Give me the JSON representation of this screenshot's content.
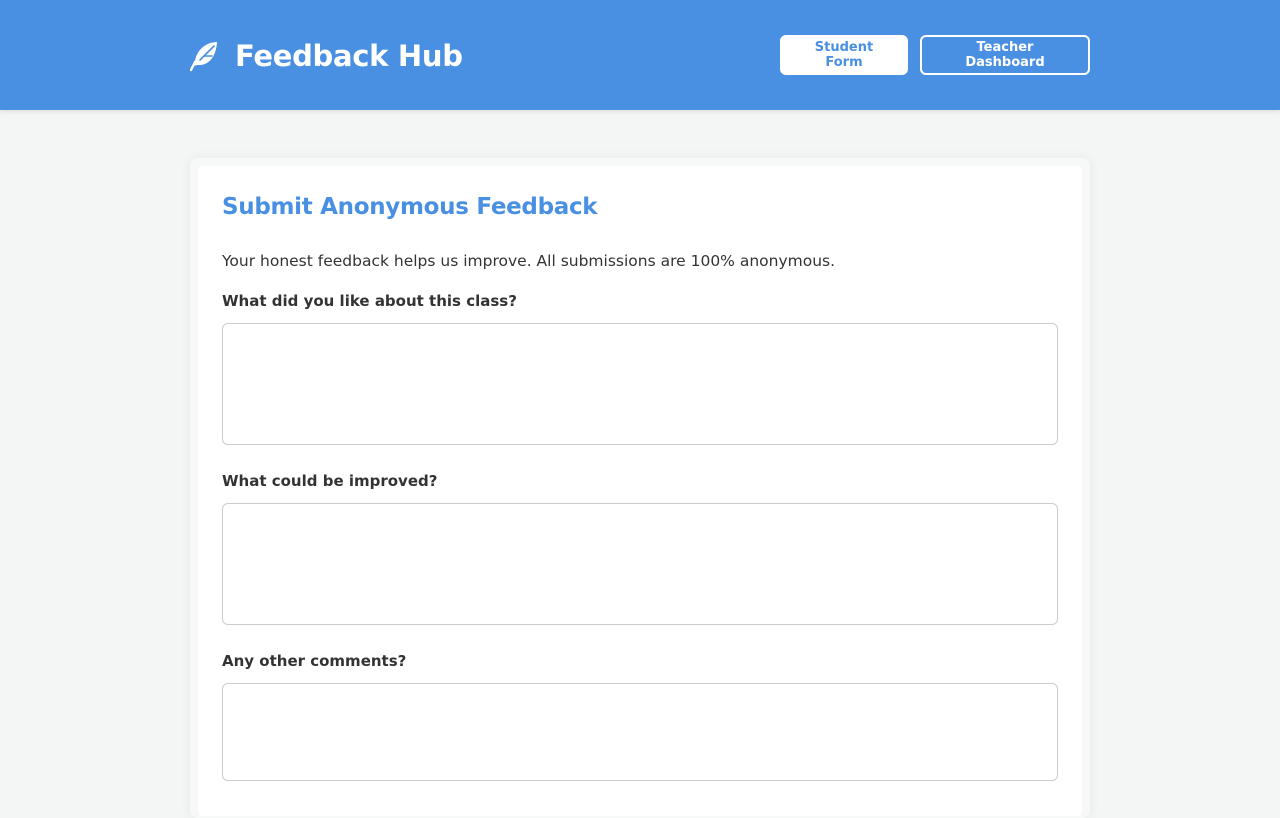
{
  "header": {
    "brand_title": "Feedback Hub",
    "brand_icon": "feather-icon",
    "nav": [
      {
        "label": "Student Form",
        "active": true
      },
      {
        "label": "Teacher Dashboard",
        "active": false
      }
    ]
  },
  "form": {
    "title": "Submit Anonymous Feedback",
    "intro": "Your honest feedback helps us improve. All submissions are 100% anonymous.",
    "fields": [
      {
        "label": "What did you like about this class?",
        "value": "",
        "placeholder": ""
      },
      {
        "label": "What could be improved?",
        "value": "",
        "placeholder": ""
      },
      {
        "label": "Any other comments?",
        "value": "",
        "placeholder": ""
      }
    ]
  },
  "colors": {
    "primary": "#4a90e2",
    "background": "#f4f6f6",
    "card": "#ffffff",
    "text": "#333333",
    "border": "#cccccc"
  }
}
